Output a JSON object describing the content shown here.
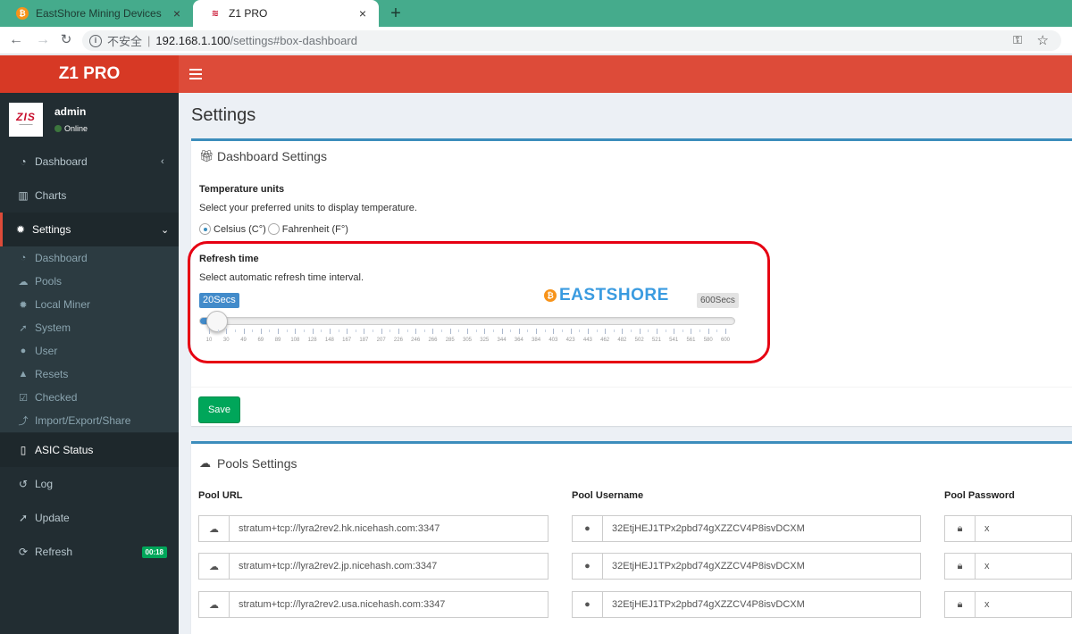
{
  "browser": {
    "tabs": [
      {
        "title": "EastShore Mining Devices",
        "favicon": "bitcoin-icon"
      },
      {
        "title": "Z1 PRO",
        "favicon": "z1-logo-icon"
      }
    ],
    "address": {
      "security": "不安全",
      "host": "192.168.1.100",
      "path": "/settings#box-dashboard"
    }
  },
  "header": {
    "logo": "Z1 PRO",
    "brand_color": "#dd4b39"
  },
  "user": {
    "name": "admin",
    "status": "Online"
  },
  "sidebar": {
    "items": [
      {
        "label": "Dashboard",
        "icon": "dashboard-icon"
      },
      {
        "label": "Charts",
        "icon": "bar-chart-icon"
      },
      {
        "label": "Settings",
        "icon": "gear-icon"
      },
      {
        "label": "ASIC Status",
        "icon": "mobile-icon"
      },
      {
        "label": "Log",
        "icon": "history-icon"
      },
      {
        "label": "Update",
        "icon": "rocket-icon"
      },
      {
        "label": "Refresh",
        "icon": "refresh-icon",
        "badge": "00:18"
      }
    ],
    "settings_submenu": [
      {
        "label": "Dashboard",
        "icon": "dashboard-icon"
      },
      {
        "label": "Pools",
        "icon": "cloud-icon"
      },
      {
        "label": "Local Miner",
        "icon": "gear-icon"
      },
      {
        "label": "System",
        "icon": "rocket-icon"
      },
      {
        "label": "User",
        "icon": "user-icon"
      },
      {
        "label": "Resets",
        "icon": "warning-icon"
      },
      {
        "label": "Checked",
        "icon": "check-square-icon"
      },
      {
        "label": "Import/Export/Share",
        "icon": "share-icon"
      }
    ]
  },
  "page": {
    "title": "Settings"
  },
  "dashboard_settings": {
    "title": "Dashboard Settings",
    "temperature": {
      "label": "Temperature units",
      "help": "Select your preferred units to display temperature.",
      "options": [
        "Celsius (C°)",
        "Fahrenheit (F°)"
      ],
      "selected": "Celsius (C°)"
    },
    "refresh": {
      "label": "Refresh time",
      "help": "Select automatic refresh time interval.",
      "current": "20Secs",
      "max_label": "600Secs",
      "value": 20,
      "min": 10,
      "max": 600,
      "tick_labels": [
        "10",
        "30",
        "49",
        "69",
        "89",
        "108",
        "128",
        "148",
        "167",
        "187",
        "207",
        "226",
        "246",
        "266",
        "285",
        "305",
        "325",
        "344",
        "364",
        "384",
        "403",
        "423",
        "443",
        "462",
        "482",
        "502",
        "521",
        "541",
        "561",
        "580",
        "600"
      ]
    },
    "save_label": "Save",
    "watermark": "EASTSHORE"
  },
  "pools_settings": {
    "title": "Pools Settings",
    "columns": [
      "Pool URL",
      "Pool Username",
      "Pool Password"
    ],
    "rows": [
      {
        "url": "stratum+tcp://lyra2rev2.hk.nicehash.com:3347",
        "username": "32EtjHEJ1TPx2pbd74gXZZCV4P8isvDCXM",
        "password": "x"
      },
      {
        "url": "stratum+tcp://lyra2rev2.jp.nicehash.com:3347",
        "username": "32EtjHEJ1TPx2pbd74gXZZCV4P8isvDCXM",
        "password": "x"
      },
      {
        "url": "stratum+tcp://lyra2rev2.usa.nicehash.com:3347",
        "username": "32EtjHEJ1TPx2pbd74gXZZCV4P8isvDCXM",
        "password": "x"
      }
    ]
  }
}
